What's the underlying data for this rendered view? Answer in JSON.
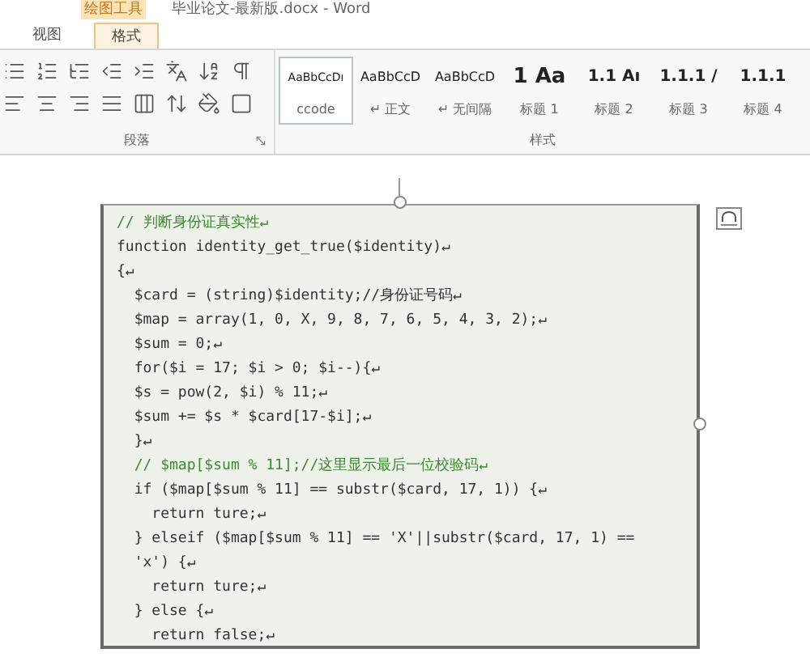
{
  "title_bar": {
    "context_label": "绘图工具",
    "title": "毕业论文-最新版.docx - Word"
  },
  "tabs": [
    {
      "label": "视图",
      "selected": false
    },
    {
      "label": "格式",
      "selected": true
    }
  ],
  "groups": [
    {
      "label": "段落"
    },
    {
      "label": "样式"
    }
  ],
  "styles": [
    {
      "preview": "AaBbCcDı",
      "name": "ccode",
      "kind": "code",
      "selected": true
    },
    {
      "preview": "AaBbCcD",
      "name": "↵ 正文",
      "kind": "normal",
      "selected": false
    },
    {
      "preview": "AaBbCcD",
      "name": "↵ 无间隔",
      "kind": "normal",
      "selected": false
    },
    {
      "preview": "1 Aa",
      "name": "标题 1",
      "kind": "h1",
      "selected": false
    },
    {
      "preview": "1.1 Aı",
      "name": "标题 2",
      "kind": "h2",
      "selected": false
    },
    {
      "preview": "1.1.1 /",
      "name": "标题 3",
      "kind": "h3",
      "selected": false
    },
    {
      "preview": "1.1.1",
      "name": "标题 4",
      "kind": "h3",
      "selected": false
    }
  ],
  "code_lines": [
    {
      "text": "// 判断身份证真实性↵",
      "kind": "comment"
    },
    {
      "text": "function identity_get_true($identity)↵",
      "kind": "code"
    },
    {
      "text": "{↵",
      "kind": "code"
    },
    {
      "text": "  $card = (string)$identity;//身份证号码↵",
      "kind": "code"
    },
    {
      "text": "  $map = array(1, 0, X, 9, 8, 7, 6, 5, 4, 3, 2);↵",
      "kind": "code"
    },
    {
      "text": "  $sum = 0;↵",
      "kind": "code"
    },
    {
      "text": "  for($i = 17; $i > 0; $i--){↵",
      "kind": "code"
    },
    {
      "text": "  $s = pow(2, $i) % 11;↵",
      "kind": "code"
    },
    {
      "text": "  $sum += $s * $card[17-$i];↵",
      "kind": "code"
    },
    {
      "text": "  }↵",
      "kind": "code"
    },
    {
      "text": "  // $map[$sum % 11];//这里显示最后一位校验码↵",
      "kind": "comment"
    },
    {
      "text": "  if ($map[$sum % 11] == substr($card, 17, 1)) {↵",
      "kind": "code"
    },
    {
      "text": "    return ture;↵",
      "kind": "code"
    },
    {
      "text": "  } elseif ($map[$sum % 11] == 'X'||substr($card, 17, 1) ==",
      "kind": "code"
    },
    {
      "text": "  'x') {↵",
      "kind": "code"
    },
    {
      "text": "    return ture;↵",
      "kind": "code"
    },
    {
      "text": "  } else {↵",
      "kind": "code"
    },
    {
      "text": "    return false;↵",
      "kind": "code"
    }
  ]
}
